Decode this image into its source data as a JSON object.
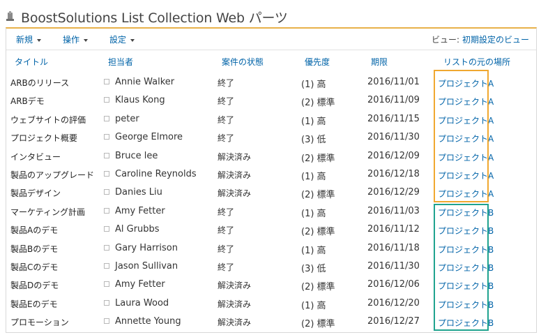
{
  "title": "BoostSolutions List Collection Web パーツ",
  "toolbar": {
    "new_label": "新規",
    "actions_label": "操作",
    "settings_label": "設定",
    "view_label": "ビュー:",
    "view_value": "初期設定のビュー"
  },
  "columns": {
    "title": "タイトル",
    "assignee": "担当者",
    "status": "案件の状態",
    "priority": "優先度",
    "due": "期限",
    "location": "リストの元の場所"
  },
  "rows": [
    {
      "title": "ARBのリリース",
      "assignee": "Annie Walker",
      "status": "終了",
      "priority": "(1) 高",
      "due": "2016/11/01",
      "location": "プロジェクトA"
    },
    {
      "title": "ARBデモ",
      "assignee": "Klaus Kong",
      "status": "終了",
      "priority": "(2) 標準",
      "due": "2016/11/09",
      "location": "プロジェクトA"
    },
    {
      "title": "ウェブサイトの評価",
      "assignee": "peter",
      "status": "終了",
      "priority": "(1) 高",
      "due": "2016/11/15",
      "location": "プロジェクトA"
    },
    {
      "title": "プロジェクト概要",
      "assignee": "George Elmore",
      "status": "終了",
      "priority": "(3) 低",
      "due": "2016/11/30",
      "location": "プロジェクトA"
    },
    {
      "title": "インタビュー",
      "assignee": "Bruce lee",
      "status": "解決済み",
      "priority": "(2) 標準",
      "due": "2016/12/09",
      "location": "プロジェクトA"
    },
    {
      "title": "製品のアップグレード",
      "assignee": "Caroline Reynolds",
      "status": "解決済み",
      "priority": "(1) 高",
      "due": "2016/12/18",
      "location": "プロジェクトA"
    },
    {
      "title": "製品デザイン",
      "assignee": "Danies Liu",
      "status": "解決済み",
      "priority": "(2) 標準",
      "due": "2016/12/29",
      "location": "プロジェクトA"
    },
    {
      "title": "マーケティング計画",
      "assignee": "Amy Fetter",
      "status": "終了",
      "priority": "(1) 高",
      "due": "2016/11/03",
      "location": "プロジェクトB"
    },
    {
      "title": "製品Aのデモ",
      "assignee": "Al Grubbs",
      "status": "終了",
      "priority": "(2) 標準",
      "due": "2016/11/12",
      "location": "プロジェクトB"
    },
    {
      "title": "製品Bのデモ",
      "assignee": "Gary Harrison",
      "status": "終了",
      "priority": "(1) 高",
      "due": "2016/11/18",
      "location": "プロジェクトB"
    },
    {
      "title": "製品Cのデモ",
      "assignee": "Jason Sullivan",
      "status": "終了",
      "priority": "(3) 低",
      "due": "2016/11/30",
      "location": "プロジェクトB"
    },
    {
      "title": "製品Dのデモ",
      "assignee": "Amy Fetter",
      "status": "解決済み",
      "priority": "(2) 標準",
      "due": "2016/12/06",
      "location": "プロジェクトB"
    },
    {
      "title": "製品Eのデモ",
      "assignee": "Laura Wood",
      "status": "解決済み",
      "priority": "(1) 高",
      "due": "2016/12/20",
      "location": "プロジェクトB"
    },
    {
      "title": "プロモーション",
      "assignee": "Annette Young",
      "status": "解決済み",
      "priority": "(2) 標準",
      "due": "2016/12/27",
      "location": "プロジェクトB"
    }
  ],
  "colors": {
    "link": "#0063a8",
    "accent_top_border": "#e8b14a",
    "highlight_group_a": "#f0a830",
    "highlight_group_b": "#1fa38f"
  }
}
